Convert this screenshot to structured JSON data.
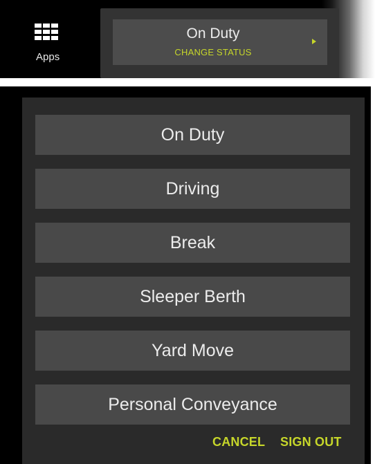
{
  "colors": {
    "accent": "#c6d62a",
    "background": "#000000",
    "card": "#4c4c4c",
    "option": "#494949",
    "panel": "#2a2a2a"
  },
  "header": {
    "apps_label": "Apps",
    "apps_icon": "grid-icon",
    "status": {
      "title": "On Duty",
      "action": "CHANGE STATUS",
      "arrow_icon": "play-arrow-icon"
    }
  },
  "menu": {
    "options": [
      {
        "label": "On Duty"
      },
      {
        "label": "Driving"
      },
      {
        "label": "Break"
      },
      {
        "label": "Sleeper Berth"
      },
      {
        "label": "Yard Move"
      },
      {
        "label": "Personal Conveyance"
      }
    ],
    "cancel_label": "CANCEL",
    "signout_label": "SIGN OUT"
  }
}
